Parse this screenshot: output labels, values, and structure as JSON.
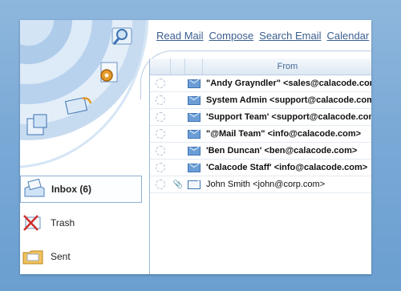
{
  "nav": {
    "read_mail": "Read Mail",
    "compose": "Compose",
    "search_email": "Search Email",
    "calendar": "Calendar"
  },
  "mail_list": {
    "column_from": "From",
    "rows": [
      {
        "from": "\"Andy Grayndler\" <sales@calacode.com>",
        "unread": true,
        "attachment": false
      },
      {
        "from": "System Admin <support@calacode.com>",
        "unread": true,
        "attachment": false
      },
      {
        "from": "'Support Team' <support@calacode.com>",
        "unread": true,
        "attachment": false
      },
      {
        "from": "\"@Mail Team\" <info@calacode.com>",
        "unread": true,
        "attachment": false
      },
      {
        "from": "'Ben Duncan' <ben@calacode.com>",
        "unread": true,
        "attachment": false
      },
      {
        "from": "'Calacode Staff' <info@calacode.com>",
        "unread": true,
        "attachment": false
      },
      {
        "from": "John Smith <john@corp.com>",
        "unread": false,
        "attachment": true
      }
    ]
  },
  "folders": [
    {
      "label": "Inbox (6)",
      "icon": "inbox-icon",
      "selected": true
    },
    {
      "label": "Trash",
      "icon": "trash-icon",
      "selected": false
    },
    {
      "label": "Sent",
      "icon": "sent-folder-icon",
      "selected": false
    }
  ],
  "colors": {
    "background": "#7aa9d6",
    "link": "#3b5f91",
    "envelope": "#6c9ed6"
  }
}
